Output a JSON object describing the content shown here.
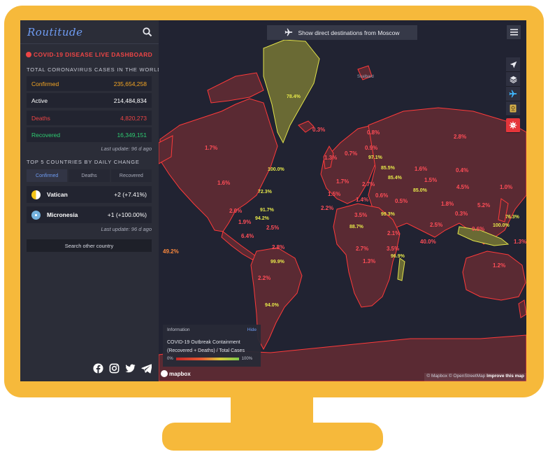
{
  "app": {
    "logo": "Routitude"
  },
  "sidebar": {
    "dashboard_title": "COVID-19 DISEASE LIVE DASHBOARD",
    "total_label": "TOTAL CORONAVIRUS CASES IN THE WORLD",
    "stats": [
      {
        "label": "Confirmed",
        "value": "235,654,258",
        "color": "#f5a623"
      },
      {
        "label": "Active",
        "value": "214,484,834",
        "color": "#ffffff"
      },
      {
        "label": "Deaths",
        "value": "4,820,273",
        "color": "#ee4545"
      },
      {
        "label": "Recovered",
        "value": "16,349,151",
        "color": "#2ecc71"
      }
    ],
    "last_update_1": "Last update: 96 d ago",
    "top5_label": "TOP 5 COUNTRIES BY DAILY CHANGE",
    "tabs": [
      "Confirmed",
      "Deaths",
      "Recovered"
    ],
    "countries": [
      {
        "name": "Vatican",
        "change": "+2 (+7.41%)"
      },
      {
        "name": "Micronesia",
        "change": "+1 (+100.00%)"
      }
    ],
    "last_update_2": "Last update: 96 d ago",
    "search_country": "Search other country",
    "social_icons": [
      "facebook-icon",
      "instagram-icon",
      "twitter-icon",
      "telegram-icon"
    ]
  },
  "map": {
    "direct_button": "Show direct destinations from Moscow",
    "controls": [
      "navigation-arrow-icon",
      "layers-icon",
      "plane-icon",
      "passport-icon",
      "covid-virus-icon"
    ],
    "labels": [
      {
        "text": "78.4%",
        "kind": "y"
      },
      {
        "text": "1.7%",
        "kind": "r"
      },
      {
        "text": "0.3%",
        "kind": "r"
      },
      {
        "text": "0.8%",
        "kind": "r"
      },
      {
        "text": "2.8%",
        "kind": "r"
      },
      {
        "text": "1.3%",
        "kind": "r"
      },
      {
        "text": "0.7%",
        "kind": "r"
      },
      {
        "text": "0.9%",
        "kind": "r"
      },
      {
        "text": "100.0%",
        "kind": "y"
      },
      {
        "text": "97.1%",
        "kind": "y"
      },
      {
        "text": "85.5%",
        "kind": "y"
      },
      {
        "text": "1.6%",
        "kind": "r"
      },
      {
        "text": "0.4%",
        "kind": "r"
      },
      {
        "text": "1.6%",
        "kind": "r"
      },
      {
        "text": "1.7%",
        "kind": "r"
      },
      {
        "text": "2.7%",
        "kind": "r"
      },
      {
        "text": "85.4%",
        "kind": "y"
      },
      {
        "text": "1.5%",
        "kind": "r"
      },
      {
        "text": "85.0%",
        "kind": "y"
      },
      {
        "text": "4.5%",
        "kind": "r"
      },
      {
        "text": "1.0%",
        "kind": "r"
      },
      {
        "text": "72.3%",
        "kind": "y"
      },
      {
        "text": "1.5%",
        "kind": "r"
      },
      {
        "text": "1.4%",
        "kind": "r"
      },
      {
        "text": "0.6%",
        "kind": "r"
      },
      {
        "text": "0.5%",
        "kind": "r"
      },
      {
        "text": "1.8%",
        "kind": "r"
      },
      {
        "text": "5.2%",
        "kind": "r"
      },
      {
        "text": "91.7%",
        "kind": "y"
      },
      {
        "text": "2.0%",
        "kind": "r"
      },
      {
        "text": "2.2%",
        "kind": "r"
      },
      {
        "text": "3.5%",
        "kind": "r"
      },
      {
        "text": "99.3%",
        "kind": "y"
      },
      {
        "text": "0.3%",
        "kind": "r"
      },
      {
        "text": "76.3%",
        "kind": "y"
      },
      {
        "text": "94.2%",
        "kind": "y"
      },
      {
        "text": "1.9%",
        "kind": "r"
      },
      {
        "text": "2.5%",
        "kind": "r"
      },
      {
        "text": "88.7%",
        "kind": "y"
      },
      {
        "text": "2.1%",
        "kind": "r"
      },
      {
        "text": "2.5%",
        "kind": "r"
      },
      {
        "text": "0.6%",
        "kind": "r"
      },
      {
        "text": "100.0%",
        "kind": "y"
      },
      {
        "text": "6.4%",
        "kind": "r"
      },
      {
        "text": "2.8%",
        "kind": "r"
      },
      {
        "text": "40.0%",
        "kind": "r"
      },
      {
        "text": "1.3%",
        "kind": "r"
      },
      {
        "text": "49.2%",
        "kind": "o"
      },
      {
        "text": "2.7%",
        "kind": "r"
      },
      {
        "text": "3.5%",
        "kind": "r"
      },
      {
        "text": "99.9%",
        "kind": "y"
      },
      {
        "text": "96.9%",
        "kind": "y"
      },
      {
        "text": "1.3%",
        "kind": "r"
      },
      {
        "text": "1.2%",
        "kind": "r"
      },
      {
        "text": "2.2%",
        "kind": "r"
      },
      {
        "text": "94.0%",
        "kind": "y"
      },
      {
        "text": "Svalbard",
        "kind": "g"
      }
    ],
    "info": {
      "title": "Information",
      "hide": "Hide",
      "description": "COVID-19 Outbreak Containment (Recovered + Deaths) / Total Cases",
      "min": "0%",
      "max": "100%"
    },
    "mapbox_logo": "mapbox",
    "attribution": "© Mapbox © OpenStreetMap",
    "improve": "Improve this map"
  }
}
